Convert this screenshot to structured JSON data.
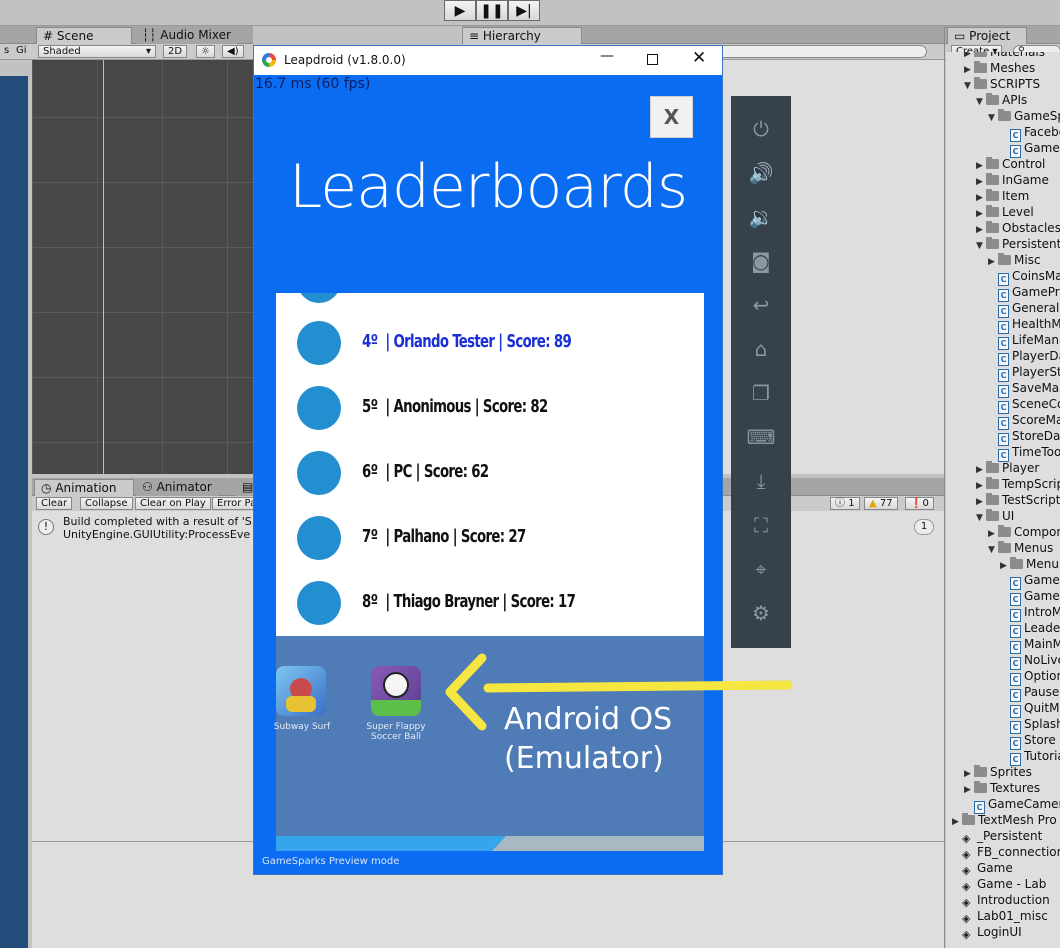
{
  "toolbar": {
    "play_icon": "play-icon",
    "pause_icon": "pause-icon",
    "step_icon": "step-icon"
  },
  "scene_panel": {
    "tabs": [
      {
        "label": "Scene"
      },
      {
        "label": "Audio Mixer"
      }
    ],
    "shading_mode": "Shaded",
    "mode_2d": "2D",
    "left_labels": [
      "s",
      "Gi"
    ]
  },
  "hierarchy": {
    "tab_label": "Hierarchy"
  },
  "bottom_panel": {
    "tabs": [
      {
        "label": "Animation"
      },
      {
        "label": "Animator"
      }
    ],
    "buttons": {
      "clear": "Clear",
      "collapse": "Collapse",
      "clear_on_play": "Clear on Play",
      "error_pause": "Error Pa"
    },
    "counts": {
      "logs": "1",
      "warnings": "77",
      "errors": "0"
    },
    "log_line1": "Build completed with a result of 'S",
    "log_line2": "UnityEngine.GUIUtility:ProcessEve",
    "log_count": "1"
  },
  "project": {
    "tab_label": "Project",
    "create_label": "Create ▾",
    "items": [
      {
        "label": "Materials",
        "type": "folder",
        "depth": 1,
        "arrow": "▶"
      },
      {
        "label": "Meshes",
        "type": "folder",
        "depth": 1,
        "arrow": "▶"
      },
      {
        "label": "SCRIPTS",
        "type": "folder",
        "depth": 1,
        "arrow": "▼"
      },
      {
        "label": "APIs",
        "type": "folder",
        "depth": 2,
        "arrow": "▼"
      },
      {
        "label": "GameSparks",
        "type": "folder",
        "depth": 3,
        "arrow": "▼"
      },
      {
        "label": "Facebook",
        "type": "script",
        "depth": 4,
        "arrow": ""
      },
      {
        "label": "GameSparks",
        "type": "script",
        "depth": 4,
        "arrow": ""
      },
      {
        "label": "Control",
        "type": "folder",
        "depth": 2,
        "arrow": "▶"
      },
      {
        "label": "InGame",
        "type": "folder",
        "depth": 2,
        "arrow": "▶"
      },
      {
        "label": "Item",
        "type": "folder",
        "depth": 2,
        "arrow": "▶"
      },
      {
        "label": "Level",
        "type": "folder",
        "depth": 2,
        "arrow": "▶"
      },
      {
        "label": "Obstacles",
        "type": "folder",
        "depth": 2,
        "arrow": "▶"
      },
      {
        "label": "Persistent",
        "type": "folder",
        "depth": 2,
        "arrow": "▼"
      },
      {
        "label": "Misc",
        "type": "folder",
        "depth": 3,
        "arrow": "▶"
      },
      {
        "label": "CoinsManager",
        "type": "script",
        "depth": 3,
        "arrow": ""
      },
      {
        "label": "GamePrefs",
        "type": "script",
        "depth": 3,
        "arrow": ""
      },
      {
        "label": "General",
        "type": "script",
        "depth": 3,
        "arrow": ""
      },
      {
        "label": "HealthManager",
        "type": "script",
        "depth": 3,
        "arrow": ""
      },
      {
        "label": "LifeManager",
        "type": "script",
        "depth": 3,
        "arrow": ""
      },
      {
        "label": "PlayerData",
        "type": "script",
        "depth": 3,
        "arrow": ""
      },
      {
        "label": "PlayerStats",
        "type": "script",
        "depth": 3,
        "arrow": ""
      },
      {
        "label": "SaveManager",
        "type": "script",
        "depth": 3,
        "arrow": ""
      },
      {
        "label": "SceneController",
        "type": "script",
        "depth": 3,
        "arrow": ""
      },
      {
        "label": "ScoreManager",
        "type": "script",
        "depth": 3,
        "arrow": ""
      },
      {
        "label": "StoreData",
        "type": "script",
        "depth": 3,
        "arrow": ""
      },
      {
        "label": "TimeTools",
        "type": "script",
        "depth": 3,
        "arrow": ""
      },
      {
        "label": "Player",
        "type": "folder",
        "depth": 2,
        "arrow": "▶"
      },
      {
        "label": "TempScripts",
        "type": "folder",
        "depth": 2,
        "arrow": "▶"
      },
      {
        "label": "TestScripts",
        "type": "folder",
        "depth": 2,
        "arrow": "▶"
      },
      {
        "label": "UI",
        "type": "folder",
        "depth": 2,
        "arrow": "▼"
      },
      {
        "label": "Components",
        "type": "folder",
        "depth": 3,
        "arrow": "▶"
      },
      {
        "label": "Menus",
        "type": "folder",
        "depth": 3,
        "arrow": "▼"
      },
      {
        "label": "MenuBase",
        "type": "folder",
        "depth": 4,
        "arrow": "▶"
      },
      {
        "label": "GameMenu",
        "type": "script",
        "depth": 4,
        "arrow": ""
      },
      {
        "label": "GameOver",
        "type": "script",
        "depth": 4,
        "arrow": ""
      },
      {
        "label": "IntroMenu",
        "type": "script",
        "depth": 4,
        "arrow": ""
      },
      {
        "label": "Leaderboards",
        "type": "script",
        "depth": 4,
        "arrow": ""
      },
      {
        "label": "MainMenu",
        "type": "script",
        "depth": 4,
        "arrow": ""
      },
      {
        "label": "NoLives",
        "type": "script",
        "depth": 4,
        "arrow": ""
      },
      {
        "label": "Options",
        "type": "script",
        "depth": 4,
        "arrow": ""
      },
      {
        "label": "PauseMenu",
        "type": "script",
        "depth": 4,
        "arrow": ""
      },
      {
        "label": "QuitMenu",
        "type": "script",
        "depth": 4,
        "arrow": ""
      },
      {
        "label": "Splash",
        "type": "script",
        "depth": 4,
        "arrow": ""
      },
      {
        "label": "Store",
        "type": "script",
        "depth": 4,
        "arrow": ""
      },
      {
        "label": "Tutorial",
        "type": "script",
        "depth": 4,
        "arrow": ""
      },
      {
        "label": "Sprites",
        "type": "folder",
        "depth": 1,
        "arrow": "▶"
      },
      {
        "label": "Textures",
        "type": "folder",
        "depth": 1,
        "arrow": "▶"
      },
      {
        "label": "GameCamera",
        "type": "script",
        "depth": 1,
        "arrow": ""
      },
      {
        "label": "TextMesh Pro",
        "type": "folder",
        "depth": 0,
        "arrow": "▶"
      },
      {
        "label": "_Persistent",
        "type": "scene",
        "depth": 0,
        "arrow": ""
      },
      {
        "label": "FB_connection",
        "type": "scene",
        "depth": 0,
        "arrow": ""
      },
      {
        "label": "Game",
        "type": "scene",
        "depth": 0,
        "arrow": ""
      },
      {
        "label": "Game - Lab",
        "type": "scene",
        "depth": 0,
        "arrow": ""
      },
      {
        "label": "Introduction",
        "type": "scene",
        "depth": 0,
        "arrow": ""
      },
      {
        "label": "Lab01_misc",
        "type": "scene",
        "depth": 0,
        "arrow": ""
      },
      {
        "label": "LoginUI",
        "type": "scene",
        "depth": 0,
        "arrow": ""
      }
    ]
  },
  "emulator": {
    "title": "Leapdroid (v1.8.0.0)",
    "fps": "16.7 ms (60 fps)",
    "close_label": "X",
    "screen_title": "Leaderboards",
    "entries": [
      {
        "rank": "4º",
        "name": "Orlando Tester",
        "score_label": "Score: 89",
        "highlight": true
      },
      {
        "rank": "5º",
        "name": "Anonimous",
        "score_label": "Score: 82",
        "highlight": false
      },
      {
        "rank": "6º",
        "name": "PC",
        "score_label": "Score: 62",
        "highlight": false
      },
      {
        "rank": "7º",
        "name": "Palhano",
        "score_label": "Score: 27",
        "highlight": false
      },
      {
        "rank": "8º",
        "name": "Thiago Brayner",
        "score_label": "Score: 17",
        "highlight": false
      }
    ],
    "apps": [
      {
        "label": "Subway Surf"
      },
      {
        "label": "Super Flappy Soccer Ball"
      }
    ],
    "preview_label": "GameSparks Preview mode",
    "colors": {
      "screen": "#0a6cf0",
      "highlight": "#1a2fd6",
      "avatar": "#238fd0"
    }
  },
  "annotation": {
    "line1": "Android OS",
    "line2": "(Emulator)",
    "color": "#f5e642"
  },
  "side_panel": {
    "icons": [
      "power-icon",
      "volume-up-icon",
      "volume-down-icon",
      "camera-icon",
      "back-icon",
      "home-icon",
      "recent-apps-icon",
      "keyboard-icon",
      "install-apk-icon",
      "fullscreen-icon",
      "location-icon",
      "settings-icon"
    ]
  }
}
